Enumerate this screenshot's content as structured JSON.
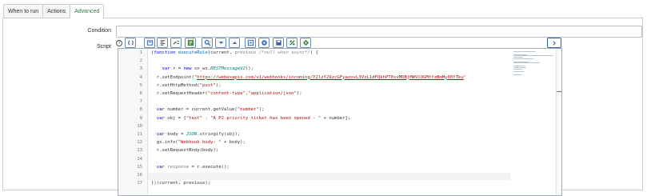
{
  "tabs": [
    {
      "label": "When to run",
      "active": false
    },
    {
      "label": "Actions",
      "active": false
    },
    {
      "label": "Advanced",
      "active": true
    }
  ],
  "form": {
    "condition_label": "Condition",
    "condition_value": "",
    "script_label": "Script"
  },
  "toolbar": {
    "icons": [
      "toggle-comment-icon",
      "format-code-icon",
      "comment-icon",
      "uncomment-icon",
      "search-icon",
      "find-next-icon",
      "find-previous-icon",
      "replace-icon",
      "script-debugger-icon",
      "save-icon",
      "toggle-syntax-icon",
      "fullscreen-icon"
    ],
    "expand_icon": "chevron-right-icon"
  },
  "editor": {
    "lines": [
      {
        "n": "1",
        "html": "(<span class='kw'>function</span> <span class='fn'>executeRule</span>(current, <span class='dim'>previous</span> <span class='cm'>/*null when async*/</span>) {"
      },
      {
        "n": "2",
        "html": ""
      },
      {
        "n": "3",
        "html": "    <span class='kw'>var</span> r = <span class='kw'>new</span> sn_ws.<span class='cls'>RESTMessageV2</span>();"
      },
      {
        "n": "4",
        "html": "  r.setEndpoint(<span class='str'>\"<span class='url'>https://webexapis.com/v1/webhooks/incoming/Y2lzY29zcGFyazovL3VzL1dFQkhPT0svMDBjMWVlOGMtYzBmMy00YTku</span>\"</span>"
      },
      {
        "n": "5",
        "html": "  r.setHttpMethod(<span class='str'>\"post\"</span>);"
      },
      {
        "n": "6",
        "html": "  r.setRequestHeader(<span class='str'>\"content-type\"</span>,<span class='str'>\"application/json\"</span>);"
      },
      {
        "n": "7",
        "html": ""
      },
      {
        "n": "8",
        "html": "  <span class='kw'>var</span> number = current.getValue(<span class='str'>\"number\"</span>);"
      },
      {
        "n": "9",
        "html": "  <span class='kw'>var</span> obj = {<span class='str'>\"text\"</span> : <span class='str'>\"A P2 priority ticket has been opened - \"</span> + number};"
      },
      {
        "n": "10",
        "html": ""
      },
      {
        "n": "11",
        "html": "  <span class='kw'>var</span> body = <span class='cls'>JSON</span>.stringify(obj);"
      },
      {
        "n": "12",
        "html": "  gs.info(<span class='str'>\"Webhook body: \"</span> + body);"
      },
      {
        "n": "13",
        "html": "  r.setRequestBody(body);"
      },
      {
        "n": "14",
        "html": ""
      },
      {
        "n": "15",
        "html": "  <span class='kw'>var</span> <span class='dim'>response</span> = r.execute();"
      },
      {
        "n": "16",
        "html": ""
      },
      {
        "n": "17",
        "html": "})(current, previous);"
      }
    ]
  },
  "colors": {
    "active_tab": "#2a7b41",
    "toolbar_border": "#6f8fa8",
    "line_numbers": "#5a7fa0"
  }
}
